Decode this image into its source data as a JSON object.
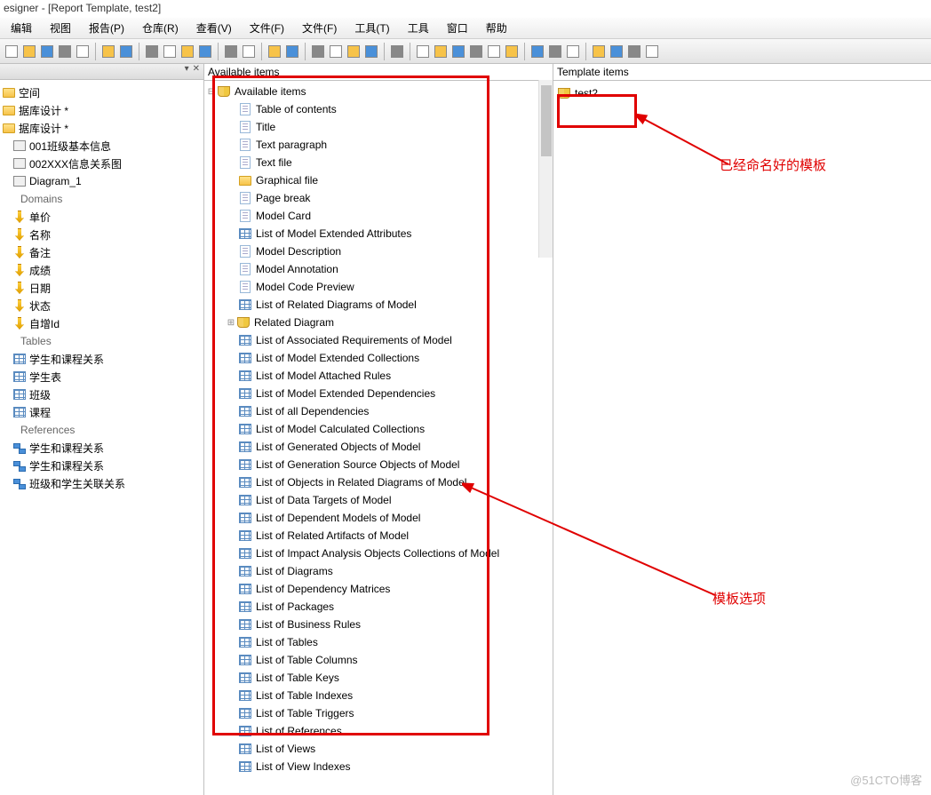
{
  "title": "esigner - [Report Template, test2]",
  "menu": [
    "编辑",
    "视图",
    "报告(P)",
    "仓库(R)",
    "查看(V)",
    "文件(F)",
    "文件(F)",
    "工具(T)",
    "工具",
    "窗口",
    "帮助"
  ],
  "left_tree": {
    "items": [
      {
        "label": "空间",
        "indent": 0,
        "icon": "folder"
      },
      {
        "label": "据库设计 *",
        "indent": 0,
        "icon": "folder"
      },
      {
        "label": "据库设计 *",
        "indent": 0,
        "icon": "folder"
      },
      {
        "label": "001班级基本信息",
        "indent": 1,
        "icon": "diagram"
      },
      {
        "label": "002XXX信息关系图",
        "indent": 1,
        "icon": "diagram"
      },
      {
        "label": "Diagram_1",
        "indent": 1,
        "icon": "diagram"
      },
      {
        "label": "Domains",
        "indent": 0,
        "icon": "header"
      },
      {
        "label": "单价",
        "indent": 1,
        "icon": "domain"
      },
      {
        "label": "名称",
        "indent": 1,
        "icon": "domain"
      },
      {
        "label": "备注",
        "indent": 1,
        "icon": "domain"
      },
      {
        "label": "成绩",
        "indent": 1,
        "icon": "domain"
      },
      {
        "label": "日期",
        "indent": 1,
        "icon": "domain"
      },
      {
        "label": "状态",
        "indent": 1,
        "icon": "domain"
      },
      {
        "label": "自增Id",
        "indent": 1,
        "icon": "domain"
      },
      {
        "label": "Tables",
        "indent": 0,
        "icon": "header"
      },
      {
        "label": "学生和课程关系",
        "indent": 1,
        "icon": "table"
      },
      {
        "label": "学生表",
        "indent": 1,
        "icon": "table"
      },
      {
        "label": "班级",
        "indent": 1,
        "icon": "table"
      },
      {
        "label": "课程",
        "indent": 1,
        "icon": "table"
      },
      {
        "label": "References",
        "indent": 0,
        "icon": "header"
      },
      {
        "label": "学生和课程关系",
        "indent": 1,
        "icon": "ref"
      },
      {
        "label": "学生和课程关系",
        "indent": 1,
        "icon": "ref"
      },
      {
        "label": "班级和学生关联关系",
        "indent": 1,
        "icon": "ref"
      }
    ]
  },
  "center": {
    "title": "Available items",
    "root": "Available items",
    "items": [
      {
        "label": "Table of contents",
        "icon": "doc",
        "indent": 1
      },
      {
        "label": "Title",
        "icon": "doc",
        "indent": 1
      },
      {
        "label": "Text paragraph",
        "icon": "doc",
        "indent": 1
      },
      {
        "label": "Text file",
        "icon": "doc",
        "indent": 1
      },
      {
        "label": "Graphical file",
        "icon": "folder",
        "indent": 1
      },
      {
        "label": "Page break",
        "icon": "doc",
        "indent": 1
      },
      {
        "label": "Model Card",
        "icon": "doc",
        "indent": 1
      },
      {
        "label": "List of Model Extended Attributes",
        "icon": "table",
        "indent": 1
      },
      {
        "label": "Model Description",
        "icon": "doc",
        "indent": 1
      },
      {
        "label": "Model Annotation",
        "icon": "doc",
        "indent": 1
      },
      {
        "label": "Model Code Preview",
        "icon": "doc",
        "indent": 1
      },
      {
        "label": "List of Related Diagrams of Model",
        "icon": "table",
        "indent": 1
      },
      {
        "label": "Related Diagram",
        "icon": "book",
        "indent": 1,
        "expandable": true
      },
      {
        "label": "List of Associated Requirements of Model",
        "icon": "table",
        "indent": 1
      },
      {
        "label": "List of Model Extended Collections",
        "icon": "table",
        "indent": 1
      },
      {
        "label": "List of Model Attached Rules",
        "icon": "table",
        "indent": 1
      },
      {
        "label": "List of Model Extended Dependencies",
        "icon": "table",
        "indent": 1
      },
      {
        "label": "List of all Dependencies",
        "icon": "table",
        "indent": 1
      },
      {
        "label": "List of Model Calculated Collections",
        "icon": "table",
        "indent": 1
      },
      {
        "label": "List of Generated Objects of Model",
        "icon": "table",
        "indent": 1
      },
      {
        "label": "List of Generation Source Objects of Model",
        "icon": "table",
        "indent": 1
      },
      {
        "label": "List of Objects in Related Diagrams of Model",
        "icon": "table",
        "indent": 1
      },
      {
        "label": "List of Data Targets of Model",
        "icon": "table",
        "indent": 1
      },
      {
        "label": "List of Dependent Models of Model",
        "icon": "table",
        "indent": 1
      },
      {
        "label": "List of Related Artifacts of Model",
        "icon": "table",
        "indent": 1
      },
      {
        "label": "List of Impact Analysis Objects Collections of Model",
        "icon": "table",
        "indent": 1
      },
      {
        "label": "List of Diagrams",
        "icon": "table",
        "indent": 1
      },
      {
        "label": "List of Dependency Matrices",
        "icon": "table",
        "indent": 1
      },
      {
        "label": "List of Packages",
        "icon": "table",
        "indent": 1
      },
      {
        "label": "List of Business Rules",
        "icon": "table",
        "indent": 1
      },
      {
        "label": "List of Tables",
        "icon": "table",
        "indent": 1
      },
      {
        "label": "List of Table Columns",
        "icon": "table",
        "indent": 1
      },
      {
        "label": "List of Table Keys",
        "icon": "table",
        "indent": 1
      },
      {
        "label": "List of Table Indexes",
        "icon": "table",
        "indent": 1
      },
      {
        "label": "List of Table Triggers",
        "icon": "table",
        "indent": 1
      },
      {
        "label": "List of References",
        "icon": "table",
        "indent": 1
      },
      {
        "label": "List of Views",
        "icon": "table",
        "indent": 1
      },
      {
        "label": "List of View Indexes",
        "icon": "table",
        "indent": 1
      }
    ]
  },
  "right": {
    "title": "Template items",
    "items": [
      {
        "label": "test2",
        "icon": "book"
      }
    ]
  },
  "annotations": {
    "named_template": "已经命名好的模板",
    "template_options": "模板选项"
  },
  "watermark": "@51CTO博客",
  "toolbar_icons": [
    "new",
    "open",
    "save",
    "saveall",
    "print",
    "props",
    "cut",
    "copy",
    "paste",
    "delete",
    "undo",
    "redo",
    "find",
    "replace",
    "wizard",
    "run1",
    "run2",
    "run3",
    "compare",
    "t1",
    "t2",
    "t3",
    "t4",
    "text",
    "folder",
    "left",
    "right",
    "g1",
    "g2",
    "g3",
    "g4",
    "g5",
    "max"
  ]
}
